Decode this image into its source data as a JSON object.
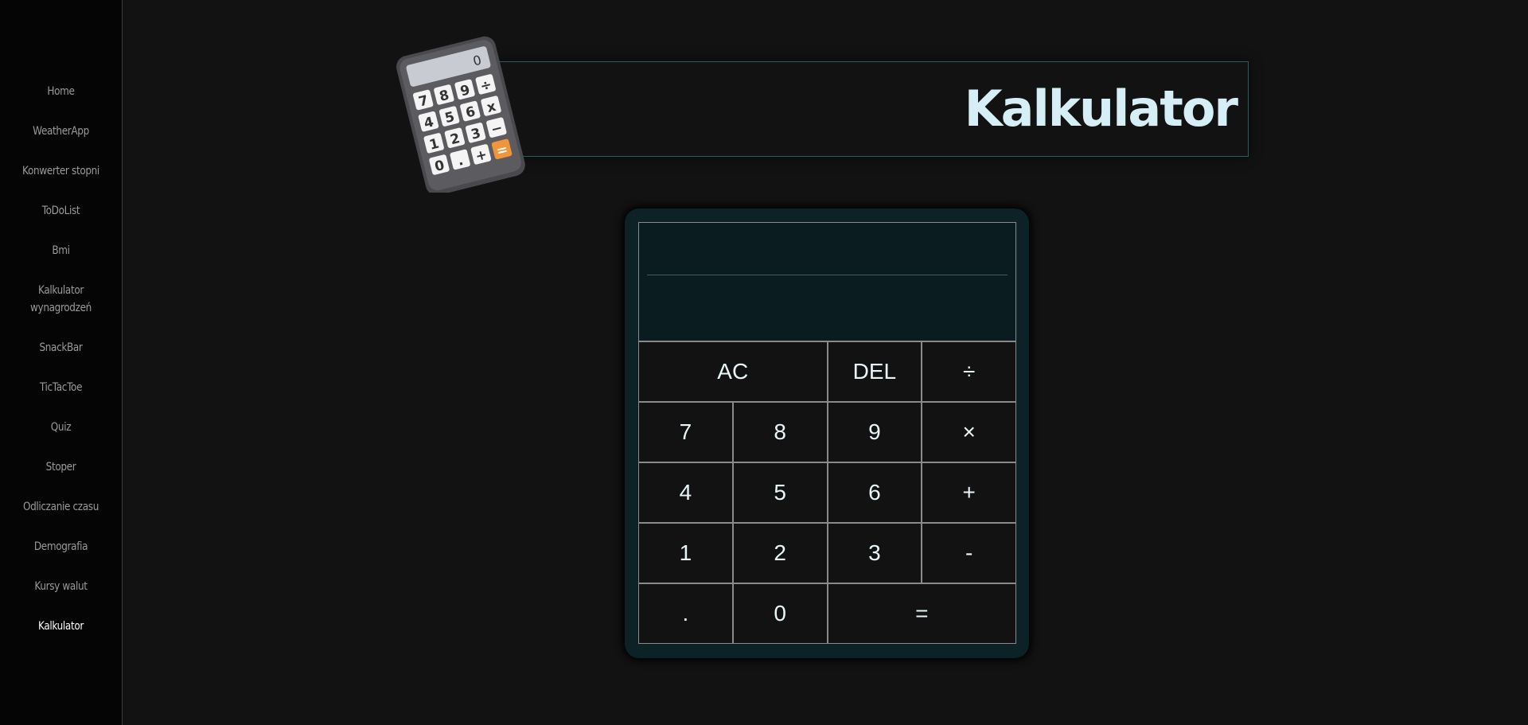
{
  "sidebar": {
    "items": [
      {
        "label": "Home"
      },
      {
        "label": "WeatherApp"
      },
      {
        "label": "Konwerter stopni"
      },
      {
        "label": "ToDoList"
      },
      {
        "label": "Bmi"
      },
      {
        "label": "Kalkulator wynagrodzeń"
      },
      {
        "label": "SnackBar"
      },
      {
        "label": "TicTacToe"
      },
      {
        "label": "Quiz"
      },
      {
        "label": "Stoper"
      },
      {
        "label": "Odliczanie czasu"
      },
      {
        "label": "Demografia"
      },
      {
        "label": "Kursy walut"
      },
      {
        "label": "Kalkulator",
        "active": true
      }
    ]
  },
  "header": {
    "title": "Kalkulator",
    "icon": "calculator-icon"
  },
  "calculator": {
    "display": {
      "previous": "",
      "current": ""
    },
    "buttons": {
      "ac": "AC",
      "del": "DEL",
      "divide": "÷",
      "seven": "7",
      "eight": "8",
      "nine": "9",
      "multiply": "×",
      "four": "4",
      "five": "5",
      "six": "6",
      "plus": "+",
      "one": "1",
      "two": "2",
      "three": "3",
      "minus": "-",
      "dot": ".",
      "zero": "0",
      "equals": "="
    }
  },
  "colors": {
    "background": "#121212",
    "sidebar": "#050505",
    "calculator_body": "#0c2227",
    "accent_orange": "#f0953a",
    "title": "#d6eef5"
  }
}
